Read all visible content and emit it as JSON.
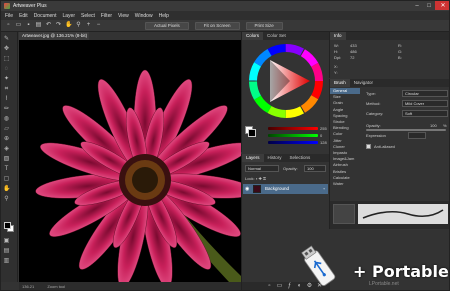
{
  "window": {
    "title": "Artweaver Plus",
    "buttons": [
      "–",
      "□",
      "✕"
    ]
  },
  "menu": [
    "File",
    "Edit",
    "Document",
    "Layer",
    "Select",
    "Filter",
    "View",
    "Window",
    "Help"
  ],
  "toolbar": {
    "actual_pixels": "Actual Pixels",
    "fit_on_screen": "Fit on Screen",
    "print_size": "Print Size"
  },
  "document": {
    "tab_title": "Artweaver.jpg @ 136.21% (8-bit)"
  },
  "status": {
    "zoom_value": "136.21",
    "zoom_tool": "Zoom tool"
  },
  "colors_panel": {
    "tabs": [
      "Colors",
      "Color Set"
    ],
    "slider_values": [
      "255",
      "0",
      "128"
    ]
  },
  "info_panel": {
    "tab": "Info",
    "left": [
      "W:",
      "H:",
      "Dpi:"
    ],
    "left_values": [
      "433",
      "486",
      "72"
    ],
    "right": [
      "R:",
      "G:",
      "B:"
    ],
    "xy": [
      "X:",
      "Y:"
    ]
  },
  "brush_panel": {
    "tabs": [
      "Brush",
      "Navigator"
    ],
    "categories": [
      "General",
      "Size",
      "Grain",
      "Angle",
      "Spacing",
      "Stroke",
      "Blending",
      "Color",
      "Jitter",
      "Cloner",
      "Impasto",
      "Image&Jam",
      "Airbrush",
      "Bristles",
      "Calculate",
      "Water"
    ],
    "selected_category": "General",
    "type_label": "Type:",
    "type_value": "Circular",
    "method_label": "Method:",
    "method_value": "Mild Cover",
    "category_label": "Category:",
    "category_value": "Soft",
    "opacity_label": "Opacity:",
    "opacity_value": "100",
    "expression_label": "Expression",
    "anti_aliased": "Anti-aliased"
  },
  "layers_panel": {
    "tabs": [
      "Layers",
      "History",
      "Selections"
    ],
    "blend_mode": "Normal",
    "opacity_label": "Opacity:",
    "opacity_value": "100",
    "lock_label": "Lock:",
    "layer_name": "Background"
  },
  "overlay": {
    "portable_text": "+ Portable",
    "watermark": "LPortable.net"
  },
  "colors": {
    "accent": "#4a6a8a",
    "panel": "#333333",
    "canvas": "#000000",
    "flower": "#c8205a"
  }
}
